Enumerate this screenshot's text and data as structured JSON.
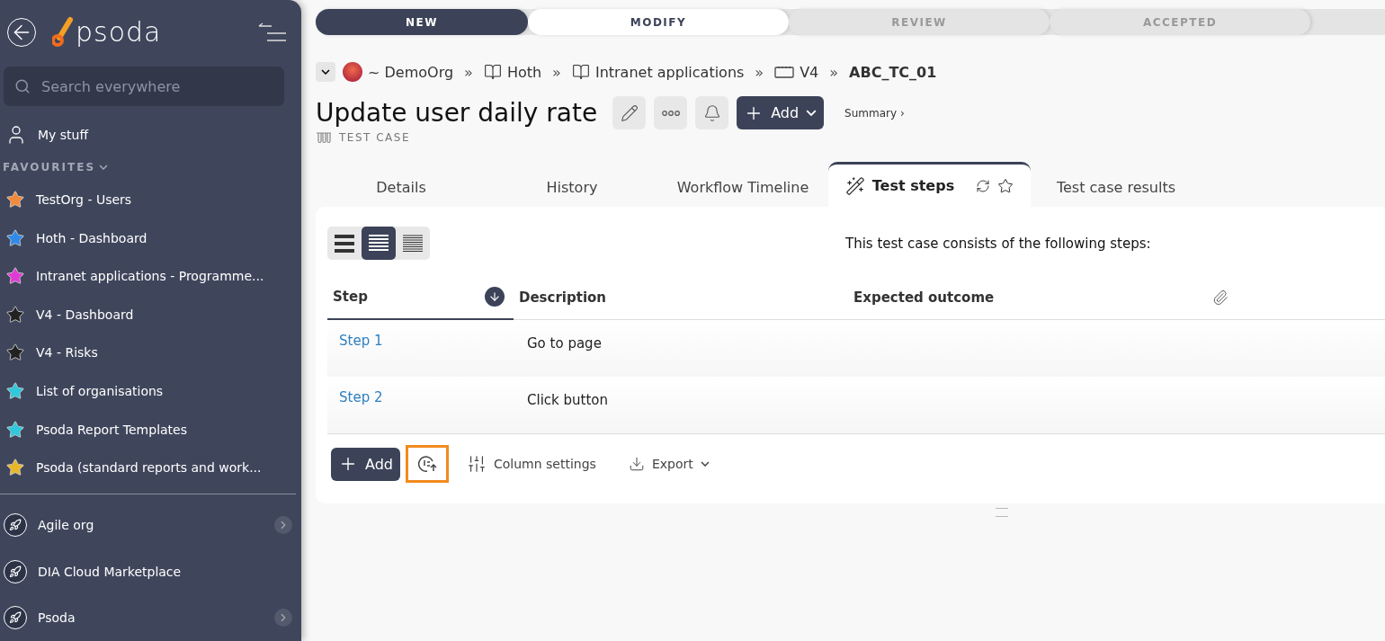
{
  "sidebar": {
    "logo": "psoda",
    "search": {
      "placeholder": "Search everywhere"
    },
    "my_stuff": "My stuff",
    "favourites": {
      "label": "FAVOURITES",
      "expanded": true,
      "items": [
        {
          "label": "TestOrg - Users",
          "color": "#f28a3c"
        },
        {
          "label": "Hoth - Dashboard",
          "color": "#2f8ae8"
        },
        {
          "label": "Intranet applications - Programme...",
          "color": "#e03ad6"
        },
        {
          "label": "V4 - Dashboard",
          "color": "#222222"
        },
        {
          "label": "V4 - Risks",
          "color": "#222222"
        },
        {
          "label": "List of organisations",
          "color": "#2fc8dc"
        },
        {
          "label": "Psoda Report Templates",
          "color": "#2fc8dc"
        },
        {
          "label": "Psoda (standard reports and work...",
          "color": "#e8b82a"
        }
      ]
    },
    "organisations": [
      {
        "label": "Agile org",
        "has_children": true
      },
      {
        "label": "DIA Cloud Marketplace",
        "has_children": false
      },
      {
        "label": "Psoda",
        "has_children": true
      }
    ]
  },
  "workflow": [
    {
      "label": "NEW",
      "completed": true,
      "selected": false
    },
    {
      "label": "MODIFY",
      "completed": false,
      "selected": true
    },
    {
      "label": "REVIEW",
      "completed": false,
      "selected": false
    },
    {
      "label": "ACCEPTED",
      "completed": false,
      "selected": false
    }
  ],
  "breadcrumb": [
    {
      "label": "~ DemoOrg",
      "kind": "org"
    },
    {
      "separator": "»",
      "label": "Hoth",
      "kind": "book"
    },
    {
      "separator": "»",
      "label": "Intranet applications",
      "kind": "book"
    },
    {
      "separator": "»",
      "label": "V4",
      "kind": "release"
    },
    {
      "separator": "»",
      "label": "ABC_TC_01",
      "kind": "current"
    }
  ],
  "title": "Update user daily rate",
  "type_label": "TEST CASE",
  "add_button": "Add",
  "summary_link": "Summary ›",
  "tabs": [
    {
      "label": "Details",
      "selected": false
    },
    {
      "label": "History",
      "selected": false
    },
    {
      "label": "Workflow Timeline",
      "selected": false
    },
    {
      "label": "Test steps",
      "selected": true
    },
    {
      "label": "Test case results",
      "selected": false
    }
  ],
  "view_modes": [
    {
      "kind": "large",
      "selected": false
    },
    {
      "kind": "medium",
      "selected": true
    },
    {
      "kind": "compact",
      "selected": false
    }
  ],
  "intro": "This test case consists of the following steps:",
  "table": {
    "columns": [
      {
        "label": "Step",
        "sorted": true
      },
      {
        "label": "Description",
        "sorted": false
      },
      {
        "label": "Expected outcome",
        "sorted": false
      }
    ],
    "rows": [
      {
        "step": "Step 1",
        "description": "Go to page"
      },
      {
        "step": "Step 2",
        "description": "Click button"
      }
    ]
  },
  "footer": {
    "add": "Add",
    "renumber_highlighted": true,
    "column_settings": "Column settings",
    "export": "Export"
  }
}
